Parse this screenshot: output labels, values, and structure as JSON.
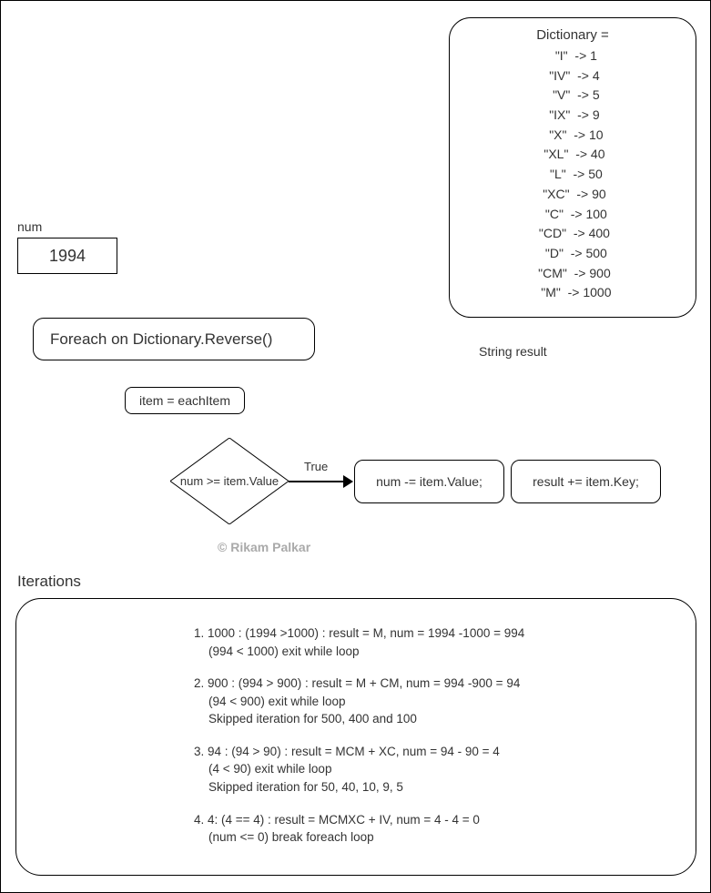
{
  "dictionary": {
    "title": "Dictionary =",
    "entries": [
      {
        "key": "\"I\"",
        "value": "1"
      },
      {
        "key": "\"IV\"",
        "value": "4"
      },
      {
        "key": "\"V\"",
        "value": "5"
      },
      {
        "key": "\"IX\"",
        "value": "9"
      },
      {
        "key": "\"X\"",
        "value": "10"
      },
      {
        "key": "\"XL\"",
        "value": "40"
      },
      {
        "key": "\"L\"",
        "value": "50"
      },
      {
        "key": "\"XC\"",
        "value": "90"
      },
      {
        "key": "\"C\"",
        "value": "100"
      },
      {
        "key": "\"CD\"",
        "value": "400"
      },
      {
        "key": "\"D\"",
        "value": "500"
      },
      {
        "key": "\"CM\"",
        "value": "900"
      },
      {
        "key": "\"M\"",
        "value": "1000"
      }
    ]
  },
  "num": {
    "label": "num",
    "value": "1994"
  },
  "foreach": "Foreach on Dictionary.Reverse()",
  "string_result": "String result",
  "item_assign": "item = eachItem",
  "condition": "num >= item.Value",
  "true_label": "True",
  "action1": "num -= item.Value;",
  "action2": "result += item.Key;",
  "copyright": "© Rikam Palkar",
  "iterations": {
    "label": "Iterations",
    "steps": [
      {
        "main": "1. 1000 : (1994 >1000) : result = M, num = 1994 -1000 = 994",
        "subs": [
          "(994 < 1000) exit while loop"
        ]
      },
      {
        "main": "2. 900 : (994 > 900) :  result = M + CM, num = 994 -900 = 94",
        "subs": [
          "(94 < 900) exit while loop",
          "Skipped iteration for 500, 400 and 100"
        ]
      },
      {
        "main": "3. 94 : (94 > 90) :  result = MCM + XC, num =  94 - 90 = 4",
        "subs": [
          "(4 < 90) exit while loop",
          "Skipped iteration for 50, 40, 10, 9, 5"
        ]
      },
      {
        "main": "4. 4: (4 == 4) : result  = MCMXC + IV, num = 4 - 4 = 0",
        "subs": [
          "(num <= 0) break foreach loop"
        ]
      }
    ]
  }
}
